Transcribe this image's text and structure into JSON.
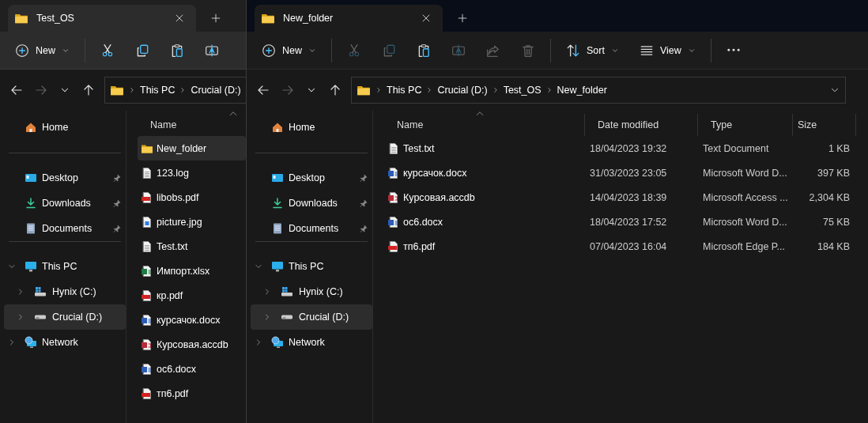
{
  "windows": [
    {
      "tab": {
        "title": "Test_OS",
        "selected": true
      },
      "toolbar": [
        {
          "kind": "new",
          "label": "New",
          "disabled": false
        },
        {
          "kind": "cut",
          "disabled": false
        },
        {
          "kind": "copy",
          "disabled": false
        },
        {
          "kind": "paste",
          "disabled": false
        },
        {
          "kind": "rename",
          "disabled": false
        }
      ],
      "nav": [
        {
          "kind": "back",
          "disabled": false
        },
        {
          "kind": "forward",
          "disabled": true
        },
        {
          "kind": "recent",
          "disabled": false
        },
        {
          "kind": "up",
          "disabled": false
        }
      ],
      "address": [
        "This PC",
        "Crucial (D:)"
      ],
      "sidebar": [
        [
          {
            "kind": "home",
            "label": "Home",
            "selected": false
          }
        ],
        [
          {
            "kind": "desktop",
            "label": "Desktop",
            "pinned": true,
            "selected": false
          },
          {
            "kind": "downloads",
            "label": "Downloads",
            "pinned": true,
            "selected": false
          },
          {
            "kind": "documents",
            "label": "Documents",
            "pinned": true,
            "selected": false
          }
        ],
        [
          {
            "kind": "pc",
            "label": "This PC",
            "expanded": true,
            "selected": false,
            "children": [
              {
                "kind": "system-drive",
                "label": "Hynix (C:)",
                "expanded": false,
                "selected": false
              },
              {
                "kind": "drive",
                "label": "Crucial (D:)",
                "expanded": false,
                "selected": true
              }
            ]
          },
          {
            "kind": "network",
            "label": "Network",
            "expanded": false,
            "selected": false
          }
        ]
      ],
      "columns": [
        {
          "label": "Name",
          "sorted": true
        }
      ],
      "rows": [
        {
          "kind": "folder",
          "name": "New_folder",
          "selected": true
        },
        {
          "kind": "text",
          "name": "123.log",
          "selected": false
        },
        {
          "kind": "pdf",
          "name": "libobs.pdf",
          "selected": false
        },
        {
          "kind": "image",
          "name": "picture.jpg",
          "selected": false
        },
        {
          "kind": "text",
          "name": "Test.txt",
          "selected": false
        },
        {
          "kind": "excel",
          "name": "Импорт.xlsx",
          "selected": false
        },
        {
          "kind": "pdf",
          "name": "кр.pdf",
          "selected": false
        },
        {
          "kind": "word",
          "name": "курсачок.docx",
          "selected": false
        },
        {
          "kind": "access",
          "name": "Курсовая.accdb",
          "selected": false
        },
        {
          "kind": "word",
          "name": "ос6.docx",
          "selected": false
        },
        {
          "kind": "pdf",
          "name": "тп6.pdf",
          "selected": false
        }
      ]
    },
    {
      "tab": {
        "title": "New_folder",
        "selected": true
      },
      "toolbar": [
        {
          "kind": "new",
          "label": "New",
          "disabled": false
        },
        {
          "kind": "cut",
          "disabled": true
        },
        {
          "kind": "copy",
          "disabled": true
        },
        {
          "kind": "paste",
          "disabled": false
        },
        {
          "kind": "rename",
          "disabled": true
        },
        {
          "kind": "share",
          "disabled": true
        },
        {
          "kind": "delete",
          "disabled": true
        },
        {
          "kind": "sort",
          "label": "Sort",
          "disabled": false
        },
        {
          "kind": "view",
          "label": "View",
          "disabled": false
        },
        {
          "kind": "more",
          "disabled": false
        }
      ],
      "nav": [
        {
          "kind": "back",
          "disabled": false
        },
        {
          "kind": "forward",
          "disabled": true
        },
        {
          "kind": "recent",
          "disabled": false
        },
        {
          "kind": "up",
          "disabled": false
        }
      ],
      "address": [
        "This PC",
        "Crucial (D:)",
        "Test_OS",
        "New_folder"
      ],
      "sidebar": [
        [
          {
            "kind": "home",
            "label": "Home",
            "selected": false
          }
        ],
        [
          {
            "kind": "desktop",
            "label": "Desktop",
            "pinned": true,
            "selected": false
          },
          {
            "kind": "downloads",
            "label": "Downloads",
            "pinned": true,
            "selected": false
          },
          {
            "kind": "documents",
            "label": "Documents",
            "pinned": true,
            "selected": false
          }
        ],
        [
          {
            "kind": "pc",
            "label": "This PC",
            "expanded": true,
            "selected": false,
            "children": [
              {
                "kind": "system-drive",
                "label": "Hynix (C:)",
                "expanded": false,
                "selected": false
              },
              {
                "kind": "drive",
                "label": "Crucial (D:)",
                "expanded": false,
                "selected": true
              }
            ]
          },
          {
            "kind": "network",
            "label": "Network",
            "expanded": false,
            "selected": false
          }
        ]
      ],
      "columns": [
        {
          "label": "Name",
          "sorted": true
        },
        {
          "label": "Date modified",
          "sorted": false
        },
        {
          "label": "Type",
          "sorted": false
        },
        {
          "label": "Size",
          "sorted": false
        }
      ],
      "rows": [
        {
          "kind": "text",
          "name": "Test.txt",
          "date": "18/04/2023 19:32",
          "type": "Text Document",
          "size": "1 KB",
          "selected": false
        },
        {
          "kind": "word",
          "name": "курсачок.docx",
          "date": "31/03/2023 23:05",
          "type": "Microsoft Word D...",
          "size": "397 KB",
          "selected": false
        },
        {
          "kind": "access",
          "name": "Курсовая.accdb",
          "date": "14/04/2023 18:39",
          "type": "Microsoft Access ...",
          "size": "2,304 KB",
          "selected": false
        },
        {
          "kind": "word",
          "name": "ос6.docx",
          "date": "18/04/2023 17:52",
          "type": "Microsoft Word D...",
          "size": "75 KB",
          "selected": false
        },
        {
          "kind": "pdf",
          "name": "тп6.pdf",
          "date": "07/04/2023 16:04",
          "type": "Microsoft Edge P...",
          "size": "184 KB",
          "selected": false
        }
      ]
    }
  ]
}
